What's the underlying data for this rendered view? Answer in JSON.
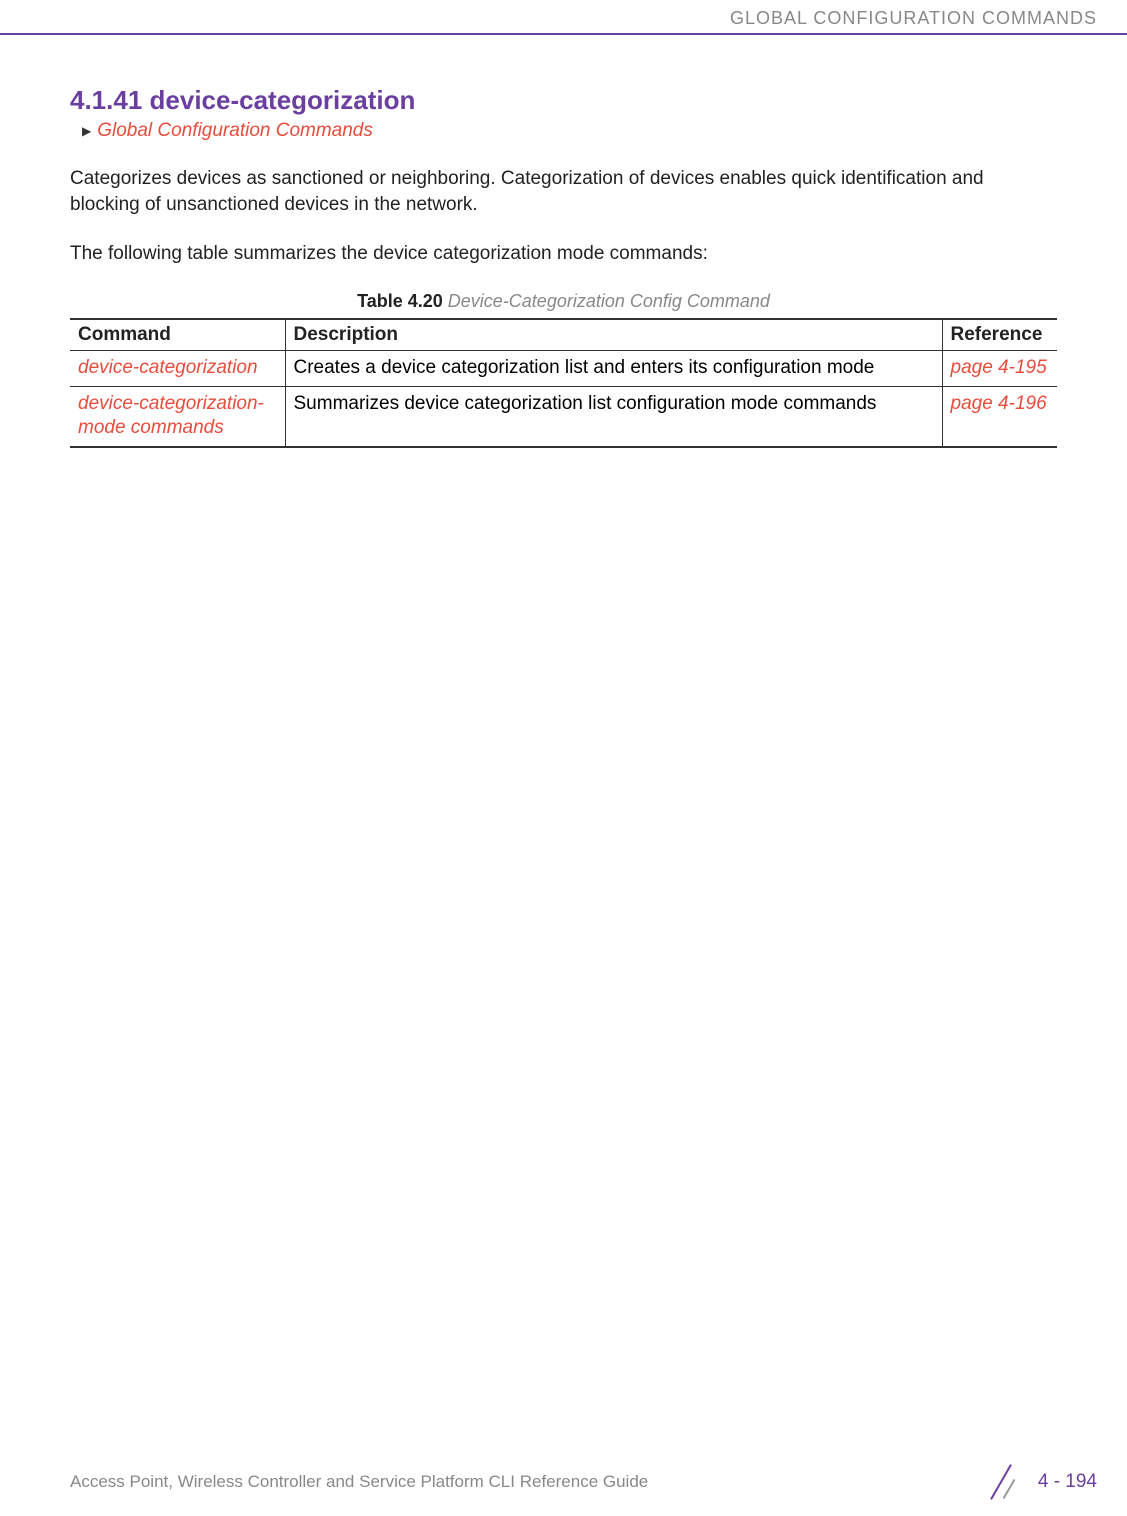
{
  "header": {
    "text": "GLOBAL CONFIGURATION COMMANDS"
  },
  "section": {
    "title": "4.1.41 device-categorization",
    "breadcrumb": "Global Configuration Commands"
  },
  "paragraphs": {
    "p1": "Categorizes devices as sanctioned or neighboring. Categorization of devices enables quick identification and blocking of unsanctioned devices in the network.",
    "p2": "The following table summarizes the device categorization mode commands:"
  },
  "table": {
    "caption_bold": "Table 4.20",
    "caption_italic": " Device-Categorization Config Command",
    "headers": {
      "command": "Command",
      "description": "Description",
      "reference": "Reference"
    },
    "rows": [
      {
        "command": "device-categorization",
        "description": "Creates a device categorization list and enters its configuration mode",
        "reference": "page 4-195"
      },
      {
        "command": "device-categorization-mode commands",
        "description": "Summarizes device categorization list configuration mode commands",
        "reference": "page 4-196"
      }
    ]
  },
  "footer": {
    "text": "Access Point, Wireless Controller and Service Platform CLI Reference Guide",
    "page": "4 - 194"
  }
}
